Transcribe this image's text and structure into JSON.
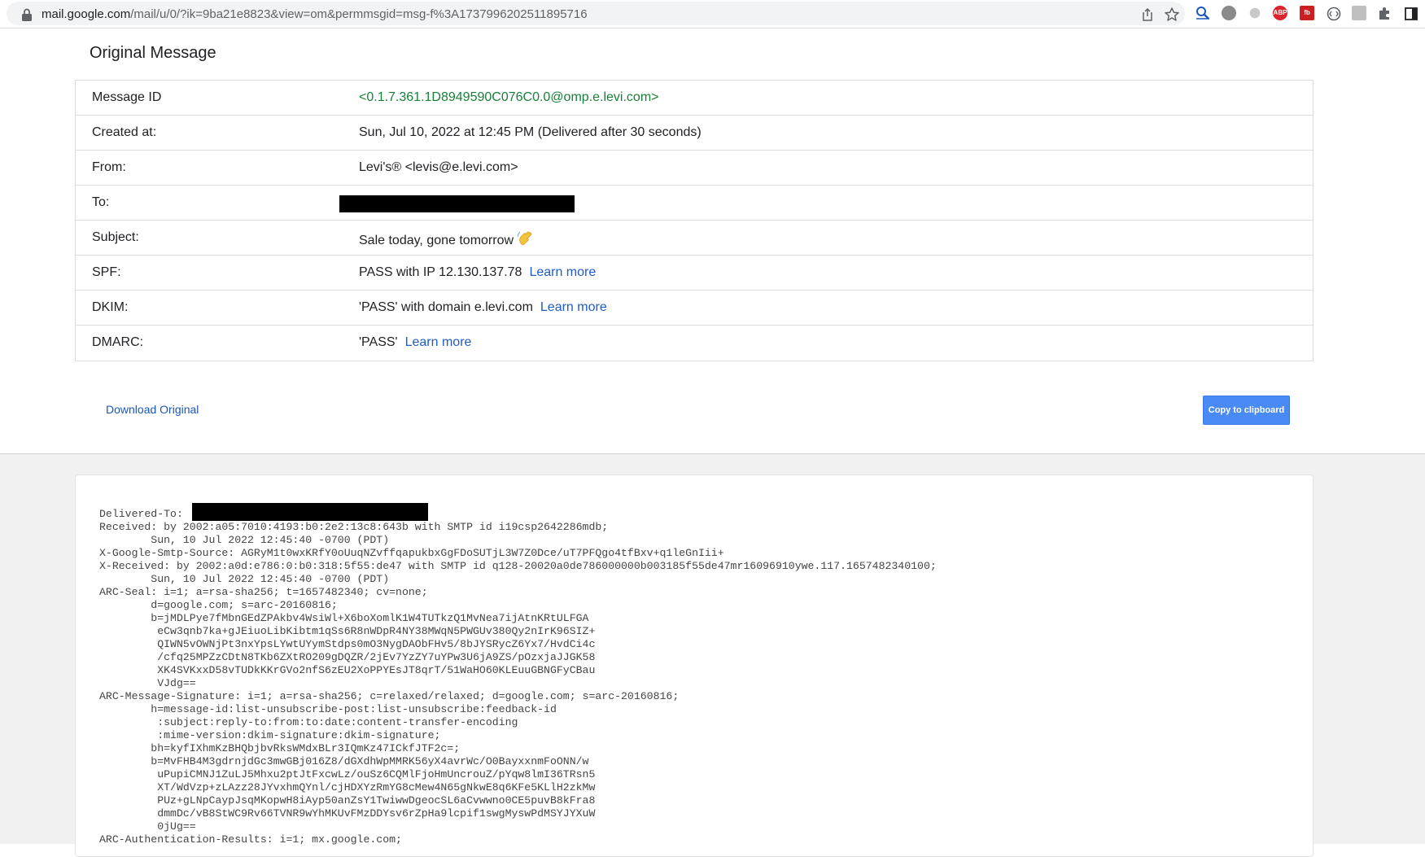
{
  "browser": {
    "url_host": "mail.google.com",
    "url_path": "/mail/u/0/?ik=9ba21e8823&view=om&permmsgid=msg-f%3A1737996202511895716",
    "extensions": [
      "share-icon",
      "star-icon",
      "zoom-extension-icon",
      "extension-icon",
      "extension-icon",
      "adblock-icon",
      "extension-icon",
      "extension-icon",
      "extension-icon",
      "puzzle-icon",
      "sidebar-icon"
    ],
    "abp_label": "ABP",
    "fb_label": "fb"
  },
  "page": {
    "title": "Original Message"
  },
  "info": {
    "message_id_label": "Message ID",
    "message_id_value": "<0.1.7.361.1D8949590C076C0.0@omp.e.levi.com>",
    "created_label": "Created at:",
    "created_value": "Sun, Jul 10, 2022 at 12:45 PM (Delivered after 30 seconds)",
    "from_label": "From:",
    "from_value": "Levi's® <levis@e.levi.com>",
    "to_label": "To:",
    "subject_label": "Subject:",
    "subject_value": "Sale today, gone tomorrow",
    "spf_label": "SPF:",
    "spf_value": "PASS with IP 12.130.137.78",
    "dkim_label": "DKIM:",
    "dkim_value": "'PASS' with domain e.levi.com",
    "dmarc_label": "DMARC:",
    "dmarc_value": "'PASS'",
    "learn_more": "Learn more"
  },
  "actions": {
    "download": "Download Original",
    "copy": "Copy to clipboard"
  },
  "raw_source": [
    "Delivered-To: ",
    "Received: by 2002:a05:7010:4193:b0:2e2:13c8:643b with SMTP id i19csp2642286mdb;",
    "        Sun, 10 Jul 2022 12:45:40 -0700 (PDT)",
    "X-Google-Smtp-Source: AGRyM1t0wxKRfY0oUuqNZvffqapukbxGgFDoSUTjL3W7Z0Dce/uT7PFQgo4tfBxv+q1leGnIii+",
    "X-Received: by 2002:a0d:e786:0:b0:318:5f55:de47 with SMTP id q128-20020a0de786000000b003185f55de47mr16096910ywe.117.1657482340100;",
    "        Sun, 10 Jul 2022 12:45:40 -0700 (PDT)",
    "ARC-Seal: i=1; a=rsa-sha256; t=1657482340; cv=none;",
    "        d=google.com; s=arc-20160816;",
    "        b=jMDLPye7fMbnGEdZPAkbv4WsiWl+X6boXomlK1W4TUTkzQ1MvNea7ijAtnKRtULFGA",
    "         eCw3qnb7ka+gJEiuoLibKibtm1qSs6R8nWDpR4NY38MWqN5PWGUv380Qy2nIrK96SIZ+",
    "         QIWN5vOWNjPt3nxYpsLYwtUYymStdps0mO3NygDAObFHv5/8bJYSRycZ6Yx7/HvdCi4c",
    "         /cfq25MPZzCDtN8TKb6ZXtRO209gDQZR/2jEv7YzZY7uYPw3U6jA9ZS/pOzxjaJJGK58",
    "         XK4SVKxxD58vTUDkKKrGVo2nfS6zEU2XoPPYEsJT8qrT/51WaHO60KLEuuGBNGFyCBau",
    "         VJdg==",
    "ARC-Message-Signature: i=1; a=rsa-sha256; c=relaxed/relaxed; d=google.com; s=arc-20160816;",
    "        h=message-id:list-unsubscribe-post:list-unsubscribe:feedback-id",
    "         :subject:reply-to:from:to:date:content-transfer-encoding",
    "         :mime-version:dkim-signature:dkim-signature;",
    "        bh=kyfIXhmKzBHQbjbvRksWMdxBLr3IQmKz47ICkfJTF2c=;",
    "        b=MvFHB4M3gdrnjdGc3mwGBj016Z8/dGXdhWpMMRK56yX4avrWc/O0BayxxnmFoONN/w",
    "         uPupiCMNJ1ZuLJ5Mhxu2ptJtFxcwLz/ouSz6CQMlFjoHmUncrouZ/pYqw8lmI36TRsn5",
    "         XT/WdVzp+zLAzz28JYvxhmQYnl/cjHDXYzRmYG8cMew4N65gNkwE8q6KFe5KLlH2zkMw",
    "         PUz+gLNpCaypJsqMKopwH8iAyp50anZsY1TwiwwDgeocSL6aCvwwno0CE5puvB8kFra8",
    "         dmmDc/vB8StWC9Rv66TVNR9wYhMKUvFMzDDYsv6rZpHa9lcpif1swgMyswPdMSYJYXuW",
    "         0jUg==",
    "ARC-Authentication-Results: i=1; mx.google.com;"
  ]
}
